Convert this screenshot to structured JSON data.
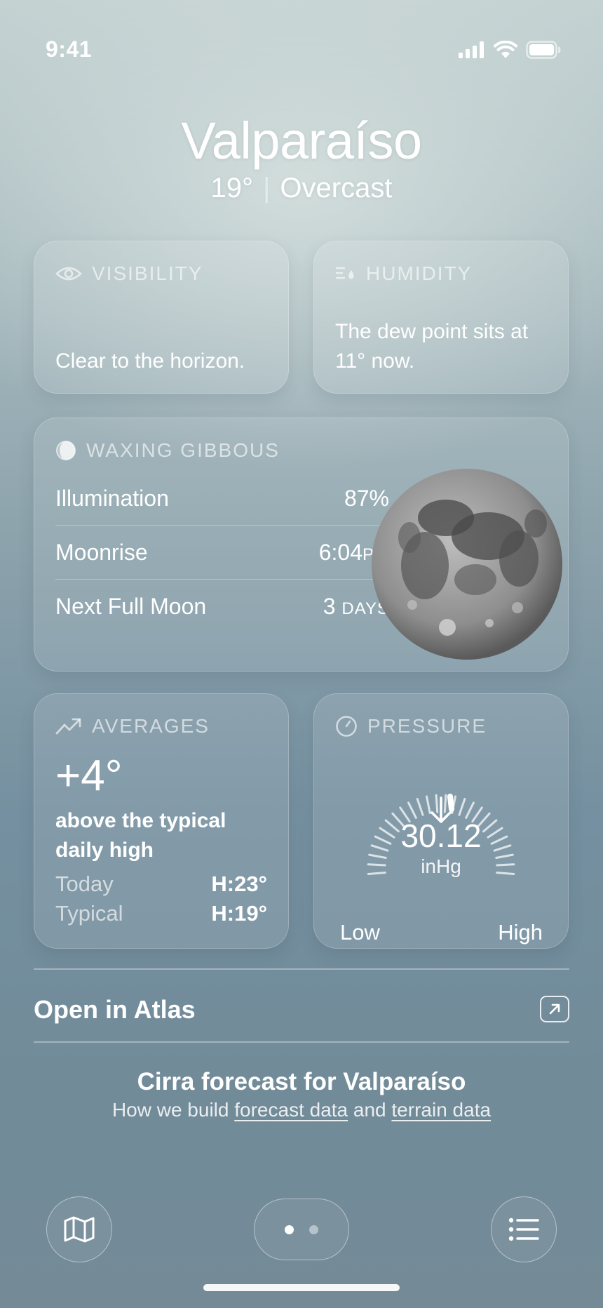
{
  "status_bar": {
    "time": "9:41"
  },
  "header": {
    "city": "Valparaíso",
    "temp": "19°",
    "separator": "|",
    "condition": "Overcast"
  },
  "visibility": {
    "title": "VISIBILITY",
    "text": "Clear to the horizon."
  },
  "humidity": {
    "title": "HUMIDITY",
    "text": "The dew point sits at 11° now."
  },
  "moon": {
    "title": "WAXING GIBBOUS",
    "rows": [
      {
        "label": "Illumination",
        "value": "87%",
        "unit": ""
      },
      {
        "label": "Moonrise",
        "value": "6:04",
        "unit": "PM"
      },
      {
        "label": "Next Full Moon",
        "value": "3",
        "unit": "DAYS"
      }
    ]
  },
  "averages": {
    "title": "AVERAGES",
    "delta": "+4°",
    "description": "above the typical daily high",
    "today_label": "Today",
    "today_value": "H:23°",
    "typical_label": "Typical",
    "typical_value": "H:19°"
  },
  "pressure": {
    "title": "PRESSURE",
    "value": "30.12",
    "unit": "inHg",
    "low": "Low",
    "high": "High",
    "trend": "falling"
  },
  "atlas": {
    "label": "Open in Atlas"
  },
  "footer": {
    "title": "Cirra forecast for Valparaíso",
    "prefix": "How we build",
    "link1": "forecast data",
    "middle": "and",
    "link2": "terrain data"
  },
  "nav": {
    "left_icon": "map-icon",
    "right_icon": "list-icon",
    "page_count": 2,
    "active_page": 1
  },
  "colors": {
    "card_fill": "rgba(255,255,255,0.10)",
    "text": "#ffffff",
    "bg_top": "#c3d1d1",
    "bg_bottom": "#748b97"
  }
}
